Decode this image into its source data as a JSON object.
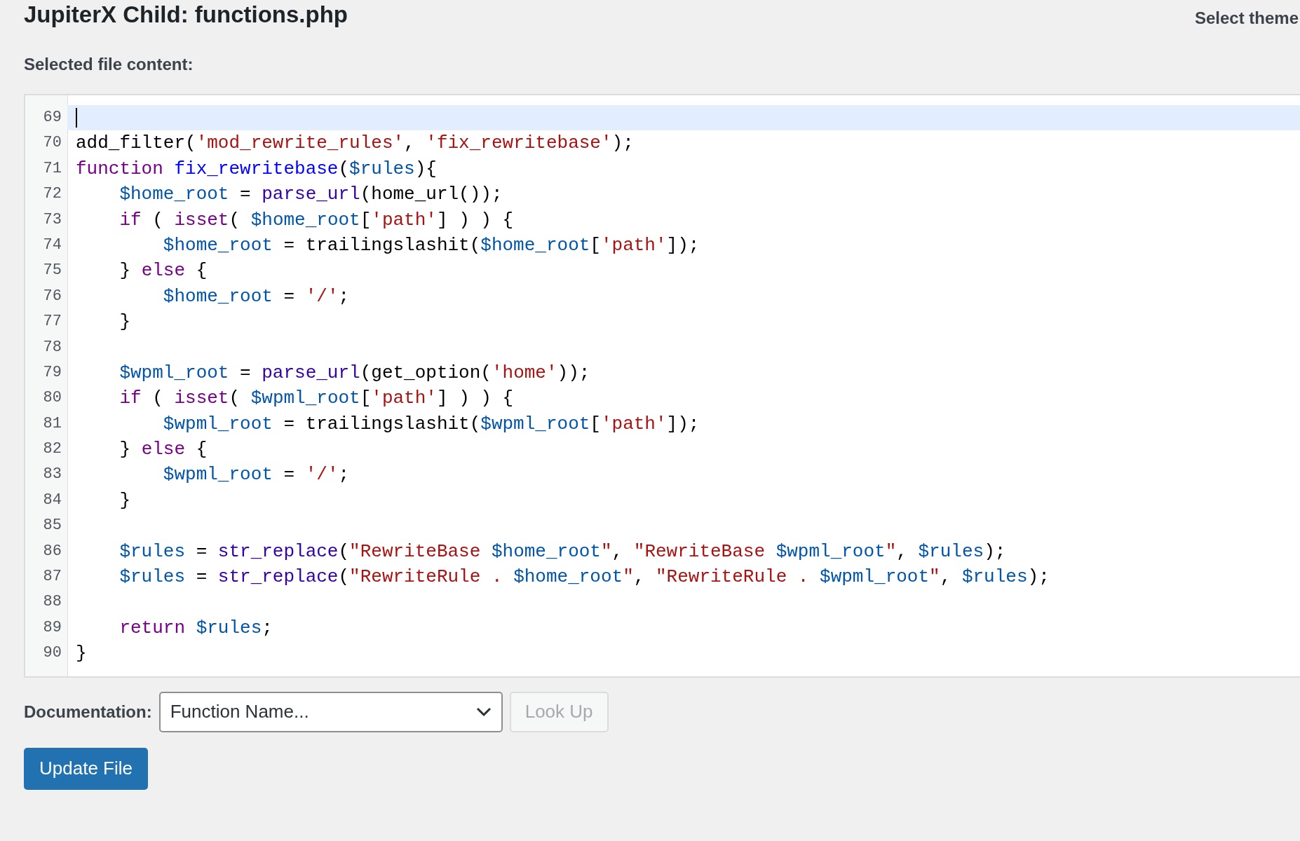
{
  "header": {
    "title": "JupiterX Child: functions.php",
    "theme_selector_label": "Select theme"
  },
  "editor": {
    "label": "Selected file content:",
    "lines": [
      {
        "number": "69",
        "current": true
      },
      {
        "number": "70",
        "current": false,
        "tokens": [
          {
            "kind": "plain",
            "text": "add_filter("
          },
          {
            "kind": "string",
            "text": "'mod_rewrite_rules'"
          },
          {
            "kind": "plain",
            "text": ", "
          },
          {
            "kind": "string",
            "text": "'fix_rewritebase'"
          },
          {
            "kind": "plain",
            "text": ");"
          }
        ]
      },
      {
        "number": "71",
        "current": false,
        "tokens": [
          {
            "kind": "keyword",
            "text": "function "
          },
          {
            "kind": "def",
            "text": "fix_rewritebase"
          },
          {
            "kind": "plain",
            "text": "("
          },
          {
            "kind": "variable",
            "text": "$rules"
          },
          {
            "kind": "plain",
            "text": "){"
          }
        ]
      },
      {
        "number": "72",
        "current": false,
        "tokens": [
          {
            "kind": "variable",
            "text": "    $home_root"
          },
          {
            "kind": "plain",
            "text": " = "
          },
          {
            "kind": "builtin",
            "text": "parse_url"
          },
          {
            "kind": "plain",
            "text": "(home_url());"
          }
        ]
      },
      {
        "number": "73",
        "current": false,
        "tokens": [
          {
            "kind": "keyword",
            "text": "    if"
          },
          {
            "kind": "plain",
            "text": " ( "
          },
          {
            "kind": "keyword",
            "text": "isset"
          },
          {
            "kind": "plain",
            "text": "( "
          },
          {
            "kind": "variable",
            "text": "$home_root"
          },
          {
            "kind": "plain",
            "text": "["
          },
          {
            "kind": "string",
            "text": "'path'"
          },
          {
            "kind": "plain",
            "text": "] ) ) {"
          }
        ]
      },
      {
        "number": "74",
        "current": false,
        "tokens": [
          {
            "kind": "variable",
            "text": "        $home_root"
          },
          {
            "kind": "plain",
            "text": " = trailingslashit("
          },
          {
            "kind": "variable",
            "text": "$home_root"
          },
          {
            "kind": "plain",
            "text": "["
          },
          {
            "kind": "string",
            "text": "'path'"
          },
          {
            "kind": "plain",
            "text": "]);"
          }
        ]
      },
      {
        "number": "75",
        "current": false,
        "tokens": [
          {
            "kind": "plain",
            "text": "    } "
          },
          {
            "kind": "keyword",
            "text": "else"
          },
          {
            "kind": "plain",
            "text": " {"
          }
        ]
      },
      {
        "number": "76",
        "current": false,
        "tokens": [
          {
            "kind": "variable",
            "text": "        $home_root"
          },
          {
            "kind": "plain",
            "text": " = "
          },
          {
            "kind": "string",
            "text": "'/'"
          },
          {
            "kind": "plain",
            "text": ";"
          }
        ]
      },
      {
        "number": "77",
        "current": false,
        "tokens": [
          {
            "kind": "plain",
            "text": "    }"
          }
        ]
      },
      {
        "number": "78",
        "current": false
      },
      {
        "number": "79",
        "current": false,
        "tokens": [
          {
            "kind": "variable",
            "text": "    $wpml_root"
          },
          {
            "kind": "plain",
            "text": " = "
          },
          {
            "kind": "builtin",
            "text": "parse_url"
          },
          {
            "kind": "plain",
            "text": "(get_option("
          },
          {
            "kind": "string",
            "text": "'home'"
          },
          {
            "kind": "plain",
            "text": "));"
          }
        ]
      },
      {
        "number": "80",
        "current": false,
        "tokens": [
          {
            "kind": "keyword",
            "text": "    if"
          },
          {
            "kind": "plain",
            "text": " ( "
          },
          {
            "kind": "keyword",
            "text": "isset"
          },
          {
            "kind": "plain",
            "text": "( "
          },
          {
            "kind": "variable",
            "text": "$wpml_root"
          },
          {
            "kind": "plain",
            "text": "["
          },
          {
            "kind": "string",
            "text": "'path'"
          },
          {
            "kind": "plain",
            "text": "] ) ) {"
          }
        ]
      },
      {
        "number": "81",
        "current": false,
        "tokens": [
          {
            "kind": "variable",
            "text": "        $wpml_root"
          },
          {
            "kind": "plain",
            "text": " = trailingslashit("
          },
          {
            "kind": "variable",
            "text": "$wpml_root"
          },
          {
            "kind": "plain",
            "text": "["
          },
          {
            "kind": "string",
            "text": "'path'"
          },
          {
            "kind": "plain",
            "text": "]);"
          }
        ]
      },
      {
        "number": "82",
        "current": false,
        "tokens": [
          {
            "kind": "plain",
            "text": "    } "
          },
          {
            "kind": "keyword",
            "text": "else"
          },
          {
            "kind": "plain",
            "text": " {"
          }
        ]
      },
      {
        "number": "83",
        "current": false,
        "tokens": [
          {
            "kind": "variable",
            "text": "        $wpml_root"
          },
          {
            "kind": "plain",
            "text": " = "
          },
          {
            "kind": "string",
            "text": "'/'"
          },
          {
            "kind": "plain",
            "text": ";"
          }
        ]
      },
      {
        "number": "84",
        "current": false,
        "tokens": [
          {
            "kind": "plain",
            "text": "    }"
          }
        ]
      },
      {
        "number": "85",
        "current": false
      },
      {
        "number": "86",
        "current": false,
        "tokens": [
          {
            "kind": "variable",
            "text": "    $rules"
          },
          {
            "kind": "plain",
            "text": " = "
          },
          {
            "kind": "builtin",
            "text": "str_replace"
          },
          {
            "kind": "plain",
            "text": "("
          },
          {
            "kind": "string",
            "text": "\"RewriteBase "
          },
          {
            "kind": "variable",
            "text": "$home_root"
          },
          {
            "kind": "string",
            "text": "\""
          },
          {
            "kind": "plain",
            "text": ", "
          },
          {
            "kind": "string",
            "text": "\"RewriteBase "
          },
          {
            "kind": "variable",
            "text": "$wpml_root"
          },
          {
            "kind": "string",
            "text": "\""
          },
          {
            "kind": "plain",
            "text": ", "
          },
          {
            "kind": "variable",
            "text": "$rules"
          },
          {
            "kind": "plain",
            "text": ");"
          }
        ]
      },
      {
        "number": "87",
        "current": false,
        "tokens": [
          {
            "kind": "variable",
            "text": "    $rules"
          },
          {
            "kind": "plain",
            "text": " = "
          },
          {
            "kind": "builtin",
            "text": "str_replace"
          },
          {
            "kind": "plain",
            "text": "("
          },
          {
            "kind": "string",
            "text": "\"RewriteRule . "
          },
          {
            "kind": "variable",
            "text": "$home_root"
          },
          {
            "kind": "string",
            "text": "\""
          },
          {
            "kind": "plain",
            "text": ", "
          },
          {
            "kind": "string",
            "text": "\"RewriteRule . "
          },
          {
            "kind": "variable",
            "text": "$wpml_root"
          },
          {
            "kind": "string",
            "text": "\""
          },
          {
            "kind": "plain",
            "text": ", "
          },
          {
            "kind": "variable",
            "text": "$rules"
          },
          {
            "kind": "plain",
            "text": ");"
          }
        ]
      },
      {
        "number": "88",
        "current": false
      },
      {
        "number": "89",
        "current": false,
        "tokens": [
          {
            "kind": "keyword",
            "text": "    return "
          },
          {
            "kind": "variable",
            "text": "$rules"
          },
          {
            "kind": "plain",
            "text": ";"
          }
        ]
      },
      {
        "number": "90",
        "current": false,
        "tokens": [
          {
            "kind": "plain",
            "text": "}"
          }
        ]
      }
    ]
  },
  "documentation": {
    "label": "Documentation:",
    "select_value": "Function Name...",
    "lookup_button": {
      "label": "Look Up",
      "disabled": true
    }
  },
  "update_button": "Update File"
}
